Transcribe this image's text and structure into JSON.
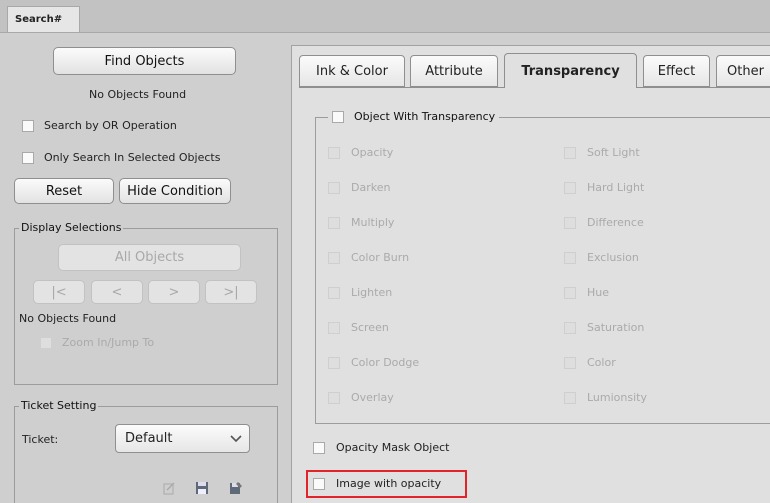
{
  "tab": {
    "title": "Search#"
  },
  "left": {
    "find_objects": "Find Objects",
    "status": "No Objects Found",
    "or_operation": "Search by OR Operation",
    "only_selected": "Only Search In Selected Objects",
    "reset": "Reset",
    "hide_condition": "Hide Condition",
    "display_selections": {
      "title": "Display Selections",
      "all_objects": "All Objects",
      "nav": [
        "|<",
        "<",
        ">",
        ">|"
      ],
      "status": "No Objects Found",
      "zoom": "Zoom In/Jump To"
    },
    "ticket_setting": {
      "title": "Ticket Setting",
      "ticket_label": "Ticket:",
      "ticket_value": "Default",
      "icons": [
        "edit-ticket-icon",
        "save-icon",
        "save-as-icon"
      ]
    }
  },
  "right": {
    "tabs": [
      "Ink & Color",
      "Attribute",
      "Transparency",
      "Effect",
      "Other"
    ],
    "active_tab": "Transparency",
    "group_title": "Object With Transparency",
    "col1": [
      "Opacity",
      "Darken",
      "Multiply",
      "Color Burn",
      "Lighten",
      "Screen",
      "Color Dodge",
      "Overlay"
    ],
    "col2": [
      "Soft Light",
      "Hard Light",
      "Difference",
      "Exclusion",
      "Hue",
      "Saturation",
      "Color",
      "Lumionsity"
    ],
    "opacity_mask": "Opacity Mask Object",
    "image_opacity": "Image with opacity",
    "highlight_color": "#e0242a"
  }
}
